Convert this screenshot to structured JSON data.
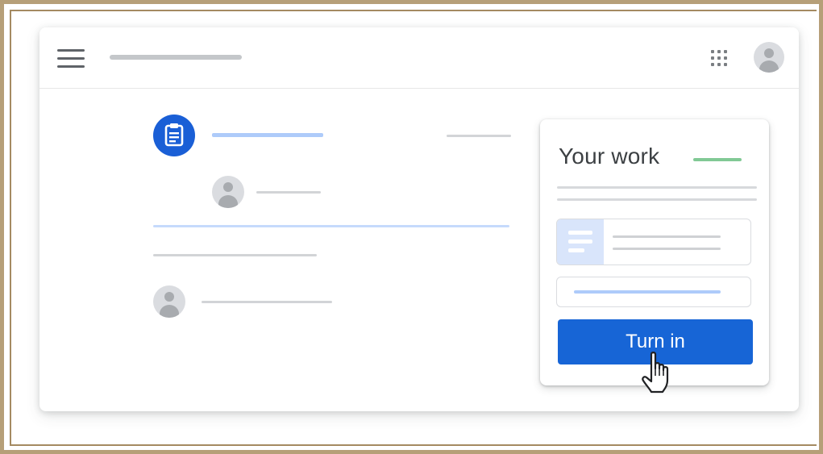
{
  "card": {
    "title": "Your work",
    "turn_in_label": "Turn in"
  },
  "icons": {
    "menu": "hamburger-menu-icon",
    "apps": "apps-grid-icon",
    "account": "account-avatar-icon",
    "assignment": "clipboard-assignment-icon",
    "attachment": "document-icon",
    "cursor": "hand-pointer-cursor-icon"
  },
  "colors": {
    "brand_blue": "#1765d6",
    "assignment_icon_blue": "#1a5fd6",
    "placeholder_line_blue": "#aecbfa",
    "placeholder_line_gray": "#d2d4d7",
    "status_green": "#81c995",
    "frame_gold": "#b69f78"
  }
}
